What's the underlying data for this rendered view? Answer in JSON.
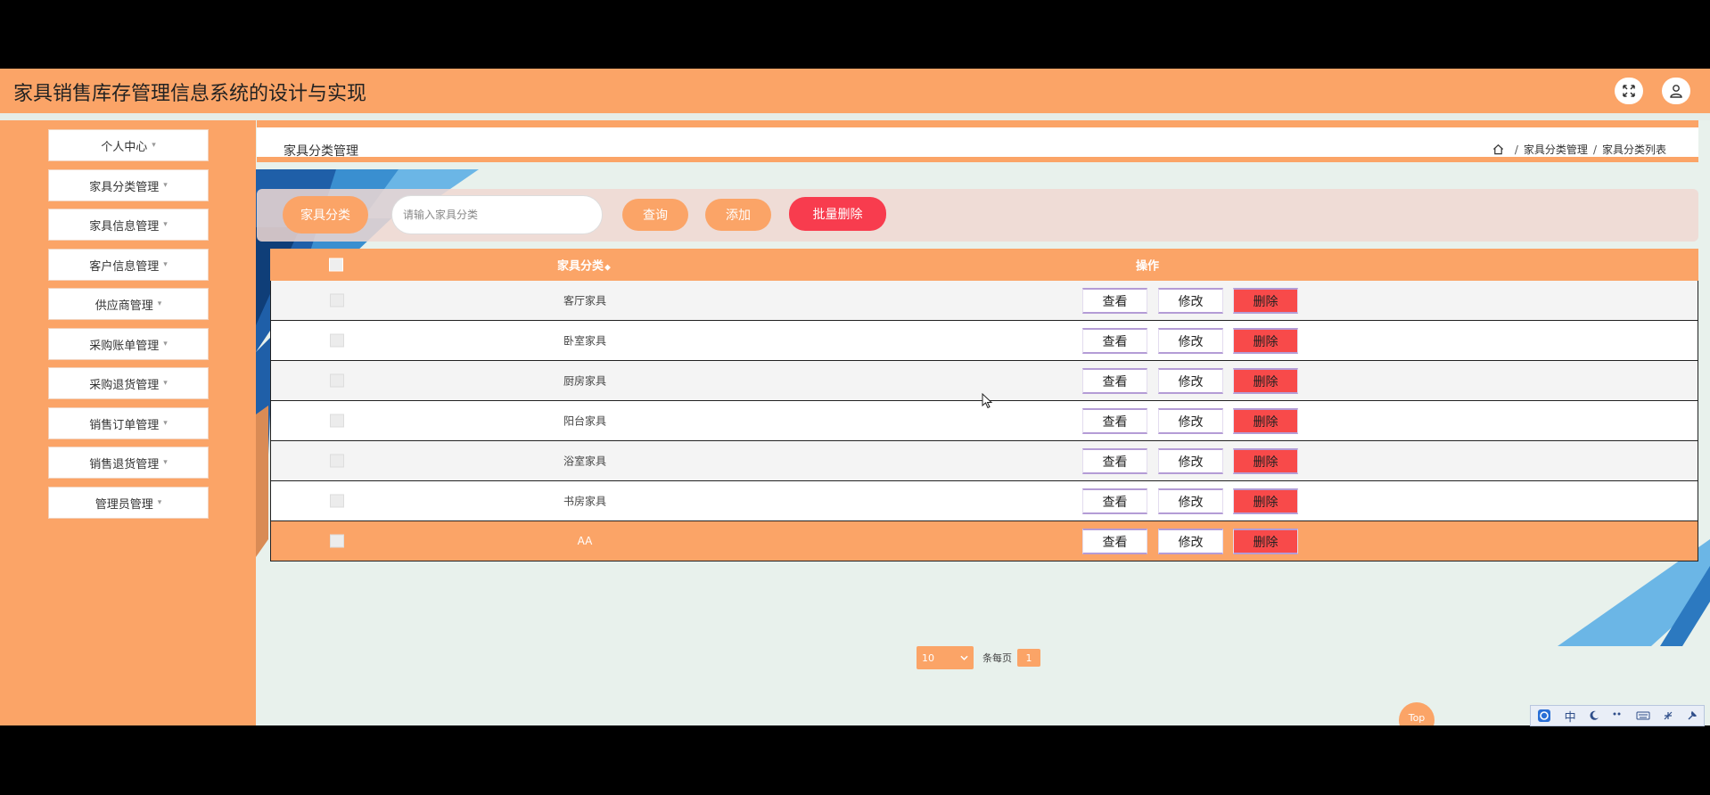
{
  "header": {
    "title": "家具销售库存管理信息系统的设计与实现",
    "fullscreen_icon": "expand-icon",
    "user_icon": "user-icon"
  },
  "sidebar": {
    "items": [
      {
        "label": "个人中心"
      },
      {
        "label": "家具分类管理"
      },
      {
        "label": "家具信息管理"
      },
      {
        "label": "客户信息管理"
      },
      {
        "label": "供应商管理"
      },
      {
        "label": "采购账单管理"
      },
      {
        "label": "采购退货管理"
      },
      {
        "label": "销售订单管理"
      },
      {
        "label": "销售退货管理"
      },
      {
        "label": "管理员管理"
      }
    ]
  },
  "page": {
    "title": "家具分类管理",
    "breadcrumb": [
      "家具分类管理",
      "家具分类列表"
    ]
  },
  "search": {
    "label": "家具分类",
    "placeholder": "请输入家具分类",
    "query_label": "查询",
    "add_label": "添加",
    "batch_delete_label": "批量删除"
  },
  "table": {
    "columns": [
      "家具分类",
      "操作"
    ],
    "sort_glyph": "◆",
    "actions": {
      "view": "查看",
      "edit": "修改",
      "delete": "删除"
    },
    "rows": [
      {
        "name": "客厅家具"
      },
      {
        "name": "卧室家具"
      },
      {
        "name": "厨房家具"
      },
      {
        "name": "阳台家具"
      },
      {
        "name": "浴室家具"
      },
      {
        "name": "书房家具"
      },
      {
        "name": "AA"
      }
    ]
  },
  "pagination": {
    "page_size": "10",
    "page_size_label": "条每页",
    "current_page": "1"
  },
  "back_to_top": "Top",
  "ime": {
    "mode": "中"
  },
  "colors": {
    "accent": "#fba467",
    "danger": "#f84a4a",
    "content_bg": "#e8f1ec"
  }
}
